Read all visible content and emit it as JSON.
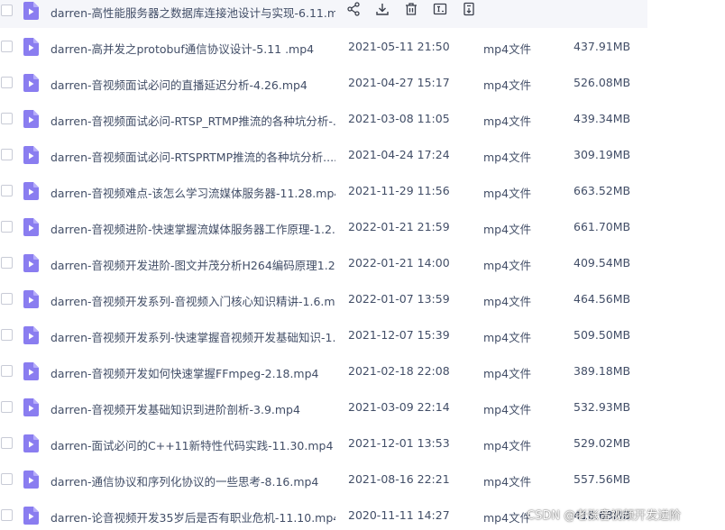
{
  "colors": {
    "text": "#424e67",
    "icon": "#8a7df0",
    "hover_bg": "#f5f6fa"
  },
  "files": [
    {
      "name": "darren-高性能服务器之数据库连接池设计与实现-6.11.m...",
      "date": "",
      "type": "",
      "size": "",
      "hovered": true
    },
    {
      "name": "darren-高并发之protobuf通信协议设计-5.11 .mp4",
      "date": "2021-05-11 21:50",
      "type": "mp4文件",
      "size": "437.91MB"
    },
    {
      "name": "darren-音视频面试必问的直播延迟分析-4.26.mp4",
      "date": "2021-04-27 15:17",
      "type": "mp4文件",
      "size": "526.08MB"
    },
    {
      "name": "darren-音视频面试必问-RTSP_RTMP推流的各种坑分析-...",
      "date": "2021-03-08 11:05",
      "type": "mp4文件",
      "size": "439.34MB"
    },
    {
      "name": "darren-音视频面试必问-RTSPRTMP推流的各种坑分析....",
      "date": "2021-04-24 17:24",
      "type": "mp4文件",
      "size": "309.19MB"
    },
    {
      "name": "darren-音视频难点-该怎么学习流媒体服务器-11.28.mp4",
      "date": "2021-11-29 11:56",
      "type": "mp4文件",
      "size": "663.52MB"
    },
    {
      "name": "darren-音视频进阶-快速掌握流媒体服务器工作原理-1.2...",
      "date": "2022-01-21 21:59",
      "type": "mp4文件",
      "size": "661.70MB"
    },
    {
      "name": "darren-音视频开发进阶-图文并茂分析H264编码原理1.2...",
      "date": "2022-01-21 14:00",
      "type": "mp4文件",
      "size": "409.54MB"
    },
    {
      "name": "darren-音视频开发系列-音视频入门核心知识精讲-1.6.m...",
      "date": "2022-01-07 13:59",
      "type": "mp4文件",
      "size": "464.56MB"
    },
    {
      "name": "darren-音视频开发系列-快速掌握音视频开发基础知识-1...",
      "date": "2021-12-07 15:39",
      "type": "mp4文件",
      "size": "509.50MB"
    },
    {
      "name": "darren-音视频开发如何快速掌握FFmpeg-2.18.mp4",
      "date": "2021-02-18 22:08",
      "type": "mp4文件",
      "size": "389.18MB"
    },
    {
      "name": "darren-音视频开发基础知识到进阶剖析-3.9.mp4",
      "date": "2021-03-09 22:14",
      "type": "mp4文件",
      "size": "532.93MB"
    },
    {
      "name": "darren-面试必问的C++11新特性代码实践-11.30.mp4",
      "date": "2021-12-01 13:53",
      "type": "mp4文件",
      "size": "529.02MB"
    },
    {
      "name": "darren-通信协议和序列化协议的一些思考-8.16.mp4",
      "date": "2021-08-16 22:21",
      "type": "mp4文件",
      "size": "557.56MB"
    },
    {
      "name": "darren-论音视频开发35岁后是否有职业危机-11.10.mp4",
      "date": "2020-11-11 14:27",
      "type": "mp4文件",
      "size": "418.68MB"
    }
  ],
  "hover_actions": [
    {
      "name": "share-icon"
    },
    {
      "name": "download-icon"
    },
    {
      "name": "delete-icon"
    },
    {
      "name": "rename-icon"
    },
    {
      "name": "more-icon"
    }
  ],
  "watermark": "CSDN @老张音视频开发进阶"
}
